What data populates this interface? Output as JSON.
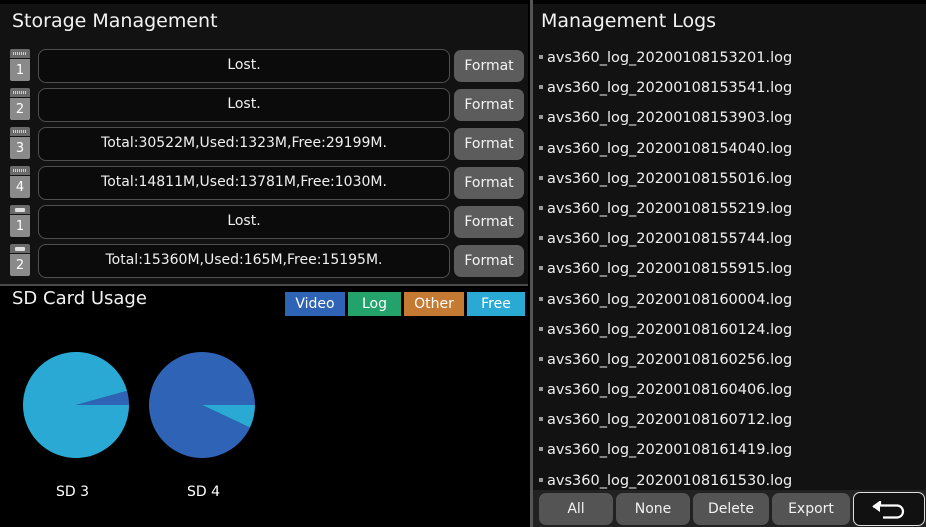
{
  "storage": {
    "title": "Storage Management",
    "format_label": "Format",
    "disks": [
      {
        "type": "hdd",
        "number": "1",
        "status": "Lost."
      },
      {
        "type": "hdd",
        "number": "2",
        "status": "Lost."
      },
      {
        "type": "hdd",
        "number": "3",
        "status": "Total:30522M,Used:1323M,Free:29199M."
      },
      {
        "type": "hdd",
        "number": "4",
        "status": "Total:14811M,Used:13781M,Free:1030M."
      },
      {
        "type": "sd",
        "number": "1",
        "status": "Lost."
      },
      {
        "type": "sd",
        "number": "2",
        "status": "Total:15360M,Used:165M,Free:15195M."
      }
    ]
  },
  "sd_usage": {
    "title": "SD Card Usage",
    "legend": [
      {
        "label": "Video",
        "color": "#2e63b6"
      },
      {
        "label": "Log",
        "color": "#23a26b"
      },
      {
        "label": "Other",
        "color": "#c47a32"
      },
      {
        "label": "Free",
        "color": "#29a9d4"
      }
    ],
    "charts": [
      {
        "label": "SD 3",
        "video_percent": 4.3,
        "free_percent": 95.7
      },
      {
        "label": "SD 4",
        "video_percent": 93.0,
        "free_percent": 7.0
      }
    ]
  },
  "logs": {
    "title": "Management Logs",
    "items": [
      "avs360_log_20200108153201.log",
      "avs360_log_20200108153541.log",
      "avs360_log_20200108153903.log",
      "avs360_log_20200108154040.log",
      "avs360_log_20200108155016.log",
      "avs360_log_20200108155219.log",
      "avs360_log_20200108155744.log",
      "avs360_log_20200108155915.log",
      "avs360_log_20200108160004.log",
      "avs360_log_20200108160124.log",
      "avs360_log_20200108160256.log",
      "avs360_log_20200108160406.log",
      "avs360_log_20200108160712.log",
      "avs360_log_20200108161419.log",
      "avs360_log_20200108161530.log"
    ]
  },
  "actions": {
    "all": "All",
    "none": "None",
    "delete": "Delete",
    "export": "Export",
    "back_icon": "back-arrow-icon"
  }
}
